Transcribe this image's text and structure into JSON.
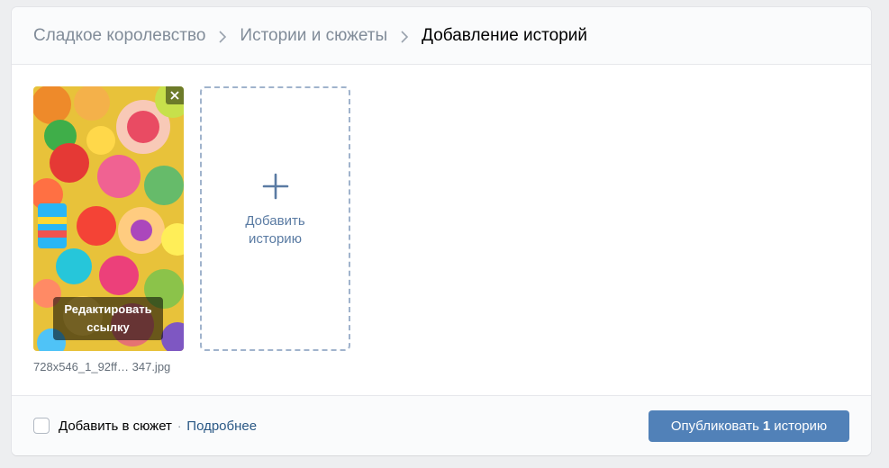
{
  "breadcrumbs": {
    "group": "Сладкое королевство",
    "section": "Истории и сюжеты",
    "current": "Добавление историй"
  },
  "story": {
    "thumbnail_icon": "candy-photo",
    "edit_label": "Редактировать ссылку",
    "filename": "728x546_1_92ff…  347.jpg"
  },
  "add_story": {
    "label": "Добавить историю",
    "icon": "plus-icon"
  },
  "footer": {
    "checkbox_label": "Добавить в сюжет",
    "separator": "·",
    "more_link": "Подробнее",
    "publish_prefix": "Опубликовать",
    "publish_count": "1",
    "publish_suffix": "историю"
  },
  "colors": {
    "accent": "#5181b8",
    "link": "#2a5885",
    "muted": "#818c99",
    "dashed_border": "#a0b3cc",
    "page_bg": "#edeef0"
  }
}
